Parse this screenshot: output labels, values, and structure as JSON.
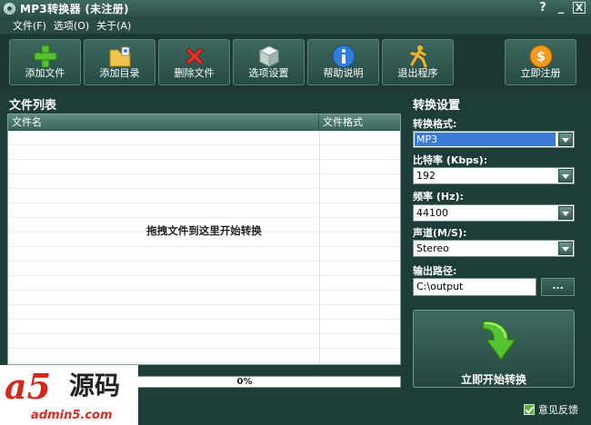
{
  "window": {
    "title": "MP3转换器 (未注册)",
    "controls": [
      "?",
      "_",
      "X"
    ]
  },
  "menu": [
    {
      "label": "文件(F)"
    },
    {
      "label": "选项(O)"
    },
    {
      "label": "关于(A)"
    }
  ],
  "toolbar": [
    {
      "label": "添加文件",
      "icon": "plus-icon"
    },
    {
      "label": "添加目录",
      "icon": "folder-icon"
    },
    {
      "label": "删除文件",
      "icon": "delete-x-icon"
    },
    {
      "label": "选项设置",
      "icon": "cube-settings-icon"
    },
    {
      "label": "帮助说明",
      "icon": "info-icon"
    },
    {
      "label": "退出程序",
      "icon": "exit-runner-icon"
    },
    {
      "label": "立即注册",
      "icon": "coin-icon"
    }
  ],
  "file_list": {
    "title": "文件列表",
    "columns": [
      "文件名",
      "文件格式"
    ],
    "rows": [],
    "empty_hint": "拖拽文件到这里开始转换"
  },
  "progress": {
    "text": "0%",
    "value": 0
  },
  "settings": {
    "title": "转换设置",
    "format": {
      "label": "转换格式:",
      "value": "MP3"
    },
    "bitrate": {
      "label": "比特率 (Kbps):",
      "value": "192"
    },
    "frequency": {
      "label": "频率 (Hz):",
      "value": "44100"
    },
    "channel": {
      "label": "声道(M/S):",
      "value": "Stereo"
    },
    "output": {
      "label": "输出路径:",
      "value": "C:\\output",
      "browse_label": "..."
    },
    "convert_label": "立即开始转换"
  },
  "status": {
    "feedback_label": "意见反馈"
  },
  "watermark": {
    "logo": "a5",
    "cn": "源码",
    "url": "admin5.com"
  },
  "colors": {
    "background": "#1f3d38",
    "accent_select": "#3d79d6",
    "watermark_red": "#d7261b"
  }
}
